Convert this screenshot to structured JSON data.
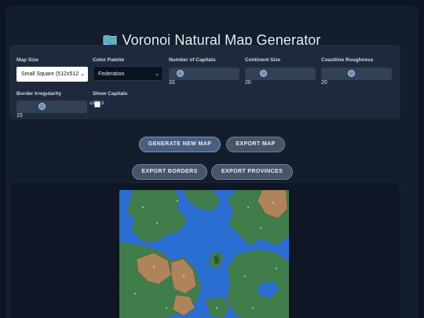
{
  "app": {
    "title": "Voronoi Natural Map Generator",
    "title_icon": "world-map-icon"
  },
  "controls": {
    "map_size": {
      "label": "Map Size",
      "value": "Small Square (512x512"
    },
    "color_palette": {
      "label": "Color Palette",
      "value": "Federation"
    },
    "capitals": {
      "label": "Number of Capitals",
      "value": "33",
      "fraction": 0.1
    },
    "continent_size": {
      "label": "Continent Size",
      "value": "20",
      "fraction": 0.25
    },
    "coastline": {
      "label": "Coastline Roughness",
      "value": "20",
      "fraction": 0.45
    },
    "border_irregularity": {
      "label": "Border Irregularity",
      "value": "15",
      "fraction": 0.35
    },
    "show_capitals": {
      "label": "Show Capitals",
      "checkbox_text": "u2713",
      "checked": true
    }
  },
  "buttons": {
    "generate": "GENERATE NEW MAP",
    "export_map": "EXPORT MAP",
    "export_borders": "EXPORT BORDERS",
    "export_provinces": "EXPORT PROVINCES"
  },
  "colors": {
    "ocean": "#2b6ed1",
    "land_green": "#3f7d4a",
    "land_tan": "#b0845a",
    "border": "#6b5a45",
    "accent": "#6b8fc2"
  }
}
